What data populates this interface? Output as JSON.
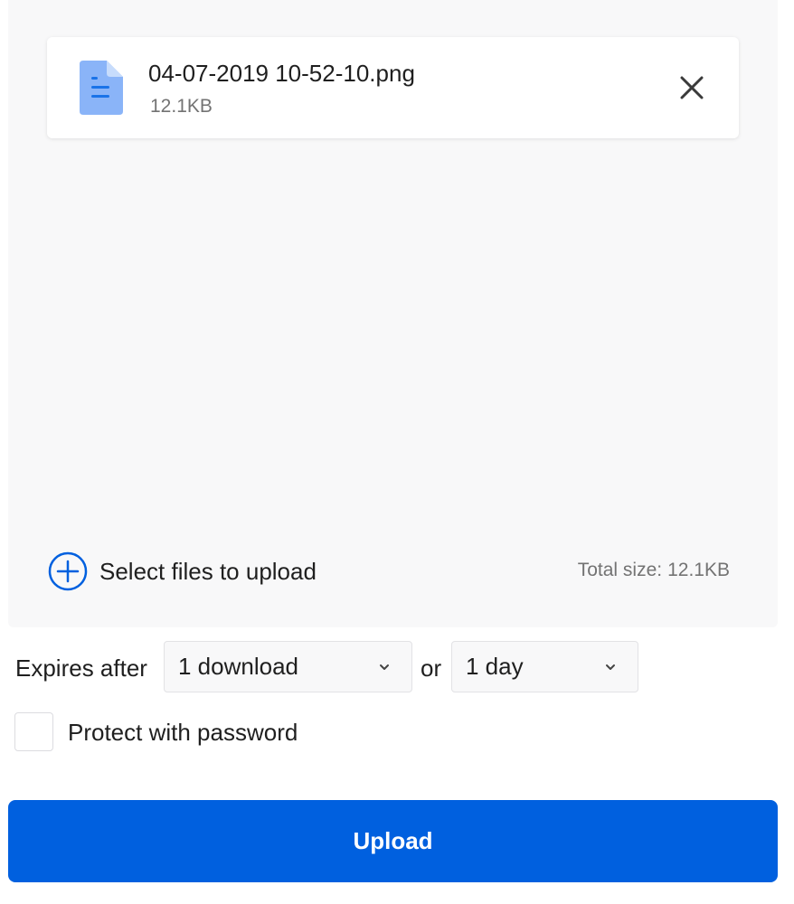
{
  "colors": {
    "accent": "#0060df",
    "file_icon": "#8ab4f8",
    "panel_bg": "#f8f8f9",
    "muted_text": "#737373"
  },
  "file": {
    "icon": "document-icon",
    "name": "04-07-2019 10-52-10.png",
    "size": "12.1KB",
    "remove_icon": "close-icon"
  },
  "add_files": {
    "icon": "plus-circle-icon",
    "label": "Select files to upload"
  },
  "total": {
    "label": "Total size:",
    "value": "12.1KB"
  },
  "expiry": {
    "label": "Expires after",
    "downloads_selected": "1 download",
    "or_label": "or",
    "days_selected": "1 day"
  },
  "password": {
    "label": "Protect with password",
    "checked": false
  },
  "upload_button": {
    "label": "Upload"
  }
}
